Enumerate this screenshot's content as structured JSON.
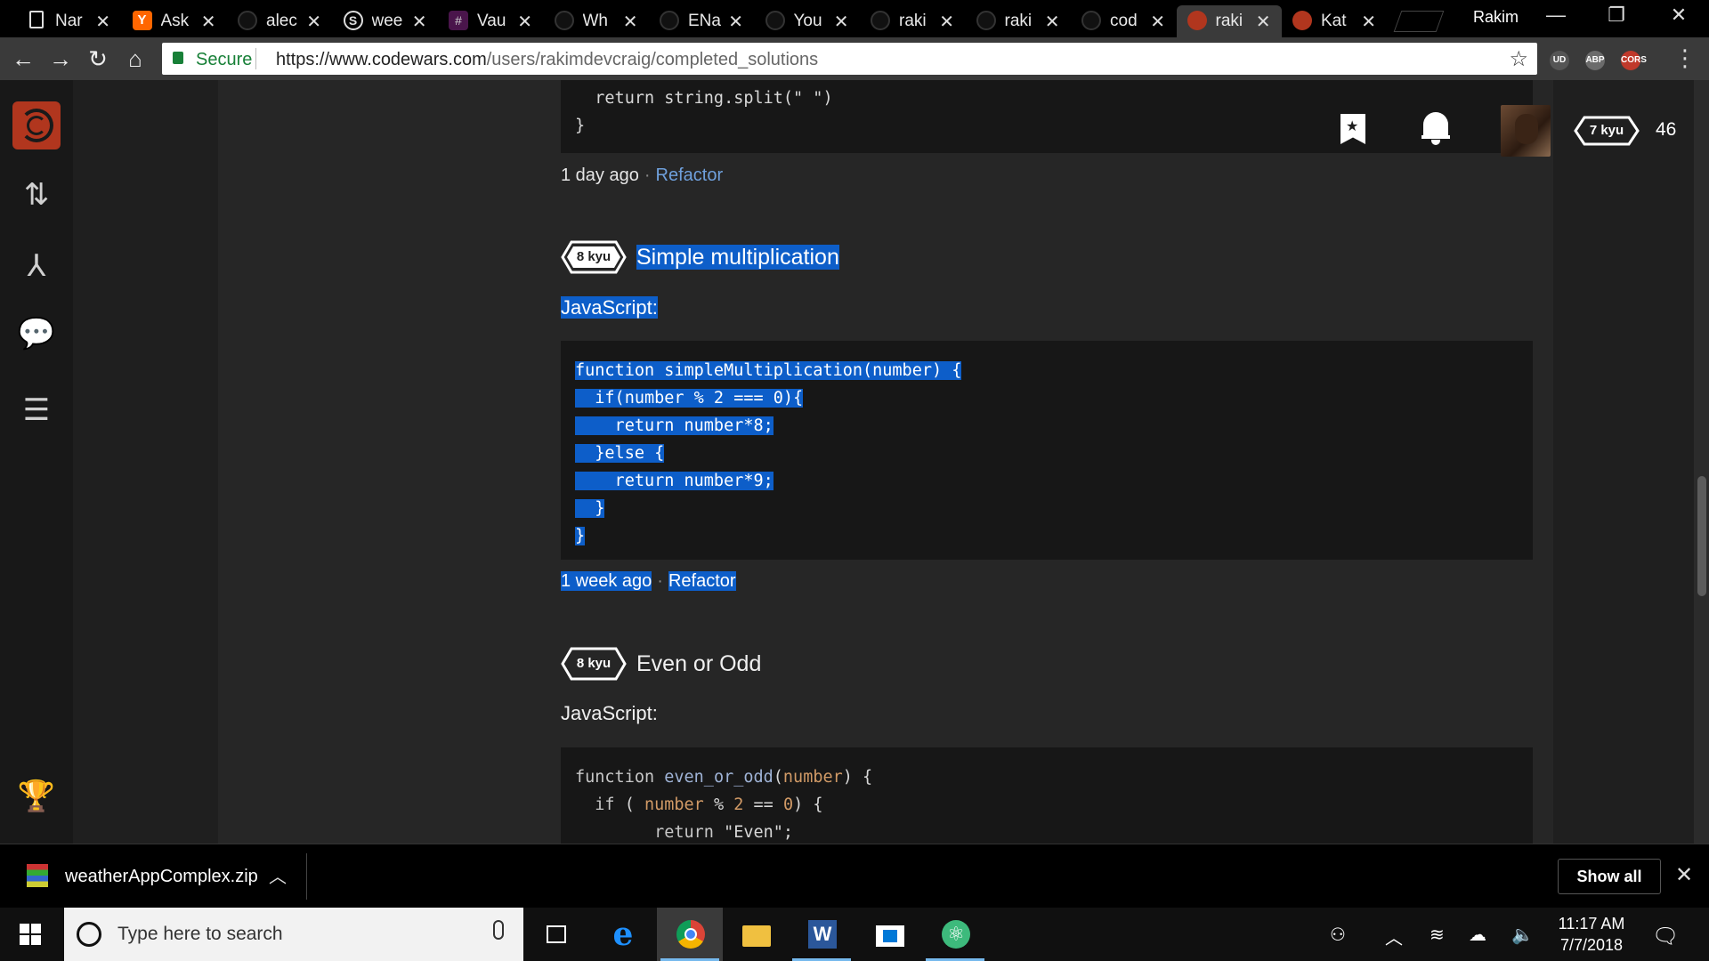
{
  "browser": {
    "tabs": [
      {
        "label": "Nar",
        "icon": "document-icon"
      },
      {
        "label": "Ask",
        "icon": "ycombinator-icon"
      },
      {
        "label": "alec",
        "icon": "github-icon"
      },
      {
        "label": "wee",
        "icon": "stackshare-icon"
      },
      {
        "label": "Vau",
        "icon": "slack-icon"
      },
      {
        "label": "Wh",
        "icon": "github-icon"
      },
      {
        "label": "ENa",
        "icon": "github-icon"
      },
      {
        "label": "You",
        "icon": "github-icon"
      },
      {
        "label": "raki",
        "icon": "github-icon"
      },
      {
        "label": "raki",
        "icon": "github-icon"
      },
      {
        "label": "cod",
        "icon": "github-icon"
      },
      {
        "label": "raki",
        "icon": "codewars-icon",
        "active": true
      },
      {
        "label": "Kat",
        "icon": "codewars-icon"
      }
    ],
    "profile_name": "Rakim",
    "secure_label": "Secure",
    "url_host": "https://www.codewars.com",
    "url_path": "/users/rakimdevcraig/completed_solutions",
    "extensions": [
      {
        "label": "UD",
        "color": "#555555"
      },
      {
        "label": "ABP",
        "color": "#6b6b6b"
      },
      {
        "label": "CORS",
        "color": "#c0392b"
      }
    ]
  },
  "header": {
    "rank": "7 kyu",
    "honor": "46"
  },
  "solutions": [
    {
      "tail_code": [
        "  return string.split(\" \")",
        "}"
      ],
      "time": "1 day ago",
      "action": "Refactor"
    },
    {
      "rank": "8 kyu",
      "title": "Simple multiplication",
      "language": "JavaScript:",
      "code": [
        "function simpleMultiplication(number) {",
        "  if(number % 2 === 0){",
        "    return number*8;",
        "  }else {",
        "    return number*9;",
        "  }",
        "}"
      ],
      "time": "1 week ago",
      "action": "Refactor"
    },
    {
      "rank": "8 kyu",
      "title": "Even or Odd",
      "language": "JavaScript:",
      "code_tokens": {
        "l1_kw": "function",
        "l1_fn": "even_or_odd",
        "l1_open": "(",
        "l1_arg": "number",
        "l1_close": ") {",
        "l2_kw": "  if",
        "l2_paren": " ( ",
        "l2_arg": "number",
        "l2_mod": " % ",
        "l2_two": "2",
        "l2_eq": " == ",
        "l2_zero": "0",
        "l2_close": ") {",
        "l3_kw": "        return",
        "l3_str": " \"Even\";"
      }
    }
  ],
  "download_shelf": {
    "filename": "weatherAppComplex.zip",
    "show_all": "Show all"
  },
  "taskbar": {
    "search_placeholder": "Type here to search",
    "time": "11:17 AM",
    "date": "7/7/2018"
  }
}
